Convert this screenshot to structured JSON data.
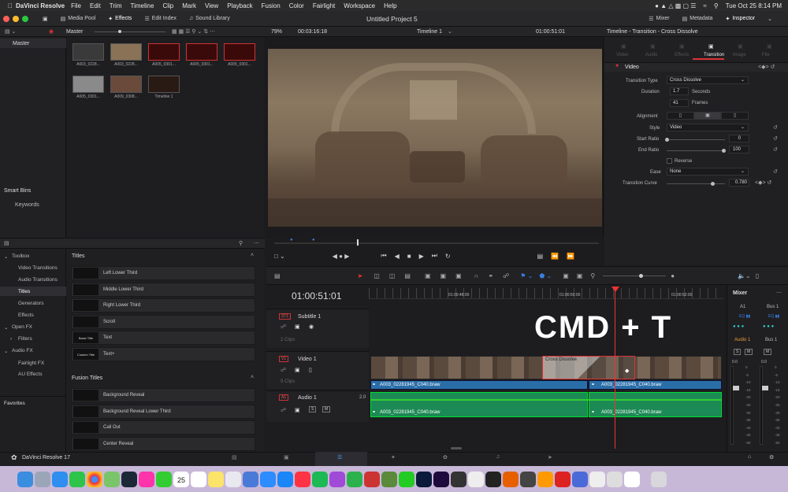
{
  "menubar": {
    "app": "DaVinci Resolve",
    "items": [
      "File",
      "Edit",
      "Trim",
      "Timeline",
      "Clip",
      "Mark",
      "View",
      "Playback",
      "Fusion",
      "Color",
      "Fairlight",
      "Workspace",
      "Help"
    ],
    "clock": "Tue Oct 25  8:14 PM"
  },
  "toolbar": {
    "media_pool": "Media Pool",
    "effects": "Effects",
    "edit_index": "Edit Index",
    "sound_library": "Sound Library",
    "project_title": "Untitled Project 5",
    "mixer": "Mixer",
    "metadata": "Metadata",
    "inspector": "Inspector"
  },
  "subbar": {
    "bin": "Master",
    "zoom": "79%",
    "timecode": "00:03:16:18",
    "timeline": "Timeline 1",
    "current_tc": "01:00:51:01",
    "inspector_title": "Timeline - Transition - Cross Dissolve"
  },
  "bins": {
    "master": "Master",
    "smart_bins": "Smart Bins",
    "keywords": "Keywords"
  },
  "clips": [
    "A003_0228...",
    "A003_0228...",
    "A005_0301...",
    "A005_0301...",
    "A005_0301...",
    "A005_0301...",
    "A009_0308...",
    "Timeline 1"
  ],
  "effects_tree": {
    "toolbox": "Toolbox",
    "video_transitions": "Video Transitions",
    "audio_transitions": "Audio Transitions",
    "titles": "Titles",
    "generators": "Generators",
    "effects": "Effects",
    "open_fx": "Open FX",
    "filters": "Filters",
    "audio_fx": "Audio FX",
    "fairlight_fx": "Fairlight FX",
    "au_effects": "AU Effects",
    "favorites": "Favorites"
  },
  "titles_section": {
    "header": "Titles",
    "items": [
      "Left Lower Third",
      "Middle Lower Third",
      "Right Lower Third",
      "Scroll",
      "Text",
      "Text+"
    ],
    "thumbs": [
      "",
      "",
      "",
      "",
      "Basic Title",
      "Custom Title"
    ]
  },
  "fusion_section": {
    "header": "Fusion Titles",
    "items": [
      "Background Reveal",
      "Background Reveal Lower Third",
      "Call Out",
      "Center Reveal"
    ]
  },
  "inspector": {
    "tabs": [
      "Video",
      "Audio",
      "Effects",
      "Transition",
      "Image",
      "File"
    ],
    "section": "Video",
    "transition_type_label": "Transition Type",
    "transition_type": "Cross Dissolve",
    "duration_label": "Duration",
    "duration_seconds": "1.7",
    "seconds": "Seconds",
    "duration_frames": "41",
    "frames": "Frames",
    "alignment_label": "Alignment",
    "style_label": "Style",
    "style": "Video",
    "start_ratio_label": "Start Ratio",
    "start_ratio": "0",
    "end_ratio_label": "End Ratio",
    "end_ratio": "100",
    "reverse": "Reverse",
    "ease_label": "Ease",
    "ease": "None",
    "curve_label": "Transition Curve",
    "curve": "0.780"
  },
  "timeline": {
    "timecode": "01:00:51:01",
    "ruler": [
      "01:00:48:00",
      "01:00:50:00",
      "01:00:52:00"
    ],
    "subtitle_track": "Subtitle 1",
    "subtitle_id": "ST1",
    "subtitle_clips": "2 Clips",
    "video_track": "Video 1",
    "video_id": "V1",
    "video_clips": "9 Clips",
    "audio_track": "Audio 1",
    "audio_id": "A1",
    "audio_ch": "2.0",
    "cross_dissolve": "Cross Dissolve",
    "clip_a": "A003_02281945_C040.braw",
    "clip_b": "A003_02281945_C040.braw",
    "overlay": "CMD + T"
  },
  "mixer": {
    "title": "Mixer",
    "a1": "A1",
    "bus1": "Bus 1",
    "audio1": "Audio 1",
    "bus1b": "Bus 1",
    "level_a": "0.0",
    "level_b": "0.0",
    "scale": [
      "0",
      "-5",
      "-10",
      "-15",
      "-20",
      "-25",
      "-30",
      "-35",
      "-40",
      "-45",
      "-50"
    ]
  },
  "footer": {
    "app": "DaVinci Resolve 17"
  },
  "dock": {
    "date": "25",
    "month": "OCT"
  }
}
